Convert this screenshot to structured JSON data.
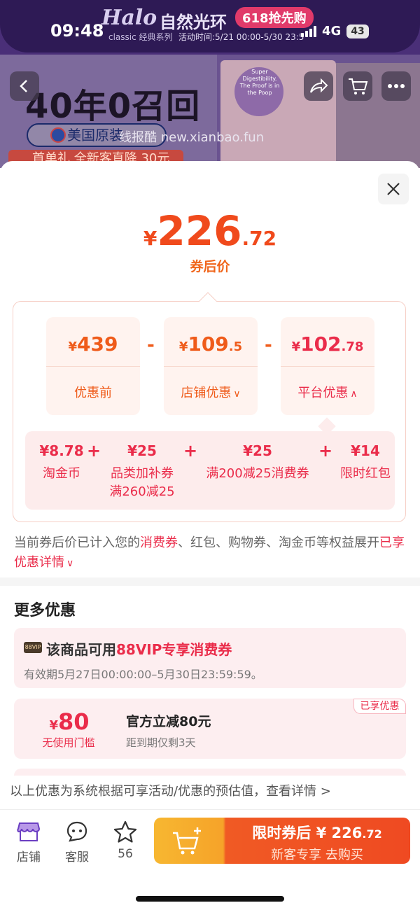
{
  "status_bar": {
    "time": "09:48",
    "network": "4G",
    "battery": "43"
  },
  "banner": {
    "brand_logo": "Halo",
    "brand_name": "自然光环",
    "brand_sub": "classic 经典系列",
    "promo_badge": "618抢先购",
    "promo_time": "活动时间:5/21 00:00-5/30 23:5",
    "headline": "40年0召回",
    "origin": "美国原装",
    "watermark": "线报酷 new.xianbao.fun",
    "strip_text": "首单礼 全新客直降 30元",
    "bag_text": "Super Digestibility. The Proof is in the Poop"
  },
  "price": {
    "currency": "¥",
    "integer": "226",
    "decimal": ".72",
    "caption": "券后价"
  },
  "calc": {
    "cards": [
      {
        "currency": "¥",
        "value": "439",
        "decimal": "",
        "label": "优惠前",
        "arrow": ""
      },
      {
        "currency": "¥",
        "value": "109",
        "decimal": ".5",
        "label": "店铺优惠",
        "arrow": "∨"
      },
      {
        "currency": "¥",
        "value": "102",
        "decimal": ".78",
        "label": "平台优惠",
        "arrow": "∧"
      }
    ],
    "operator": "-"
  },
  "breakdown": {
    "items": [
      {
        "amount": "¥8.78",
        "label": "淘金币",
        "label2": ""
      },
      {
        "amount": "¥25",
        "label": "品类加补券",
        "label2": "满260减25"
      },
      {
        "amount": "¥25",
        "label": "满200减25消费券",
        "label2": ""
      },
      {
        "amount": "¥14",
        "label": "限时红包",
        "label2": ""
      }
    ],
    "operator": "+"
  },
  "notice": {
    "prefix": "当前券后价已计入您的",
    "highlight": "消费券",
    "middle": "、红包、购物券、淘金币等权益展开",
    "link": "已享优惠详情",
    "link_arrow": "∨"
  },
  "more": {
    "title": "更多优惠",
    "vip": {
      "tag": "88VIP",
      "title_prefix": "该商品可用",
      "title_highlight": "88VIP专享消费券",
      "validity": "有效期5月27日00:00:00–5月30日23:59:59。"
    },
    "coupon": {
      "badge": "已享优惠",
      "currency": "¥",
      "amount": "80",
      "condition": "无使用门槛",
      "title": "官方立减80元",
      "subtitle": "距到期仅剩3天"
    },
    "disclaimer": "以上优惠为系统根据可享活动/优惠的预估值，查看详情 >"
  },
  "action_bar": {
    "store_label": "店铺",
    "service_label": "客服",
    "favorite_count": "56",
    "buy_line1_prefix": "限时券后 ¥ ",
    "buy_price_int": "226",
    "buy_price_dec": ".72",
    "buy_line2": "新客专享  去购买"
  },
  "colors": {
    "accent_orange": "#ef5b1a",
    "accent_red": "#ea2c4a",
    "buy_gradient_start": "#f7b731",
    "buy_gradient_end": "#ef4a22"
  }
}
